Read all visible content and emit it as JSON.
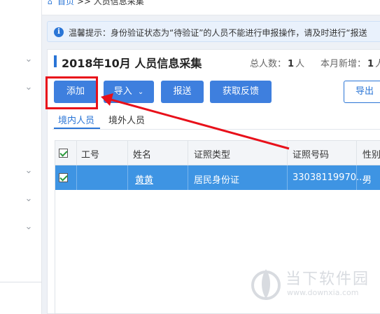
{
  "breadcrumb": {
    "home": "首页",
    "separator": ">>",
    "current": "人员信息采集"
  },
  "notice": {
    "text": "温馨提示：身份验证状态为“待验证”的人员不能进行申报操作，请及时进行“报送"
  },
  "header": {
    "title": "2018年10月  人员信息采集",
    "total_label": "总人数：",
    "total_value": "1",
    "total_unit": "人",
    "new_label": "本月新增：",
    "new_value": "1",
    "new_unit": "人"
  },
  "toolbar": {
    "add_label": "添加",
    "import_label": "导入",
    "submit_label": "报送",
    "feedback_label": "获取反馈",
    "export_label": "导出"
  },
  "tabs": [
    {
      "label": "境内人员",
      "active": true
    },
    {
      "label": "境外人员",
      "active": false
    }
  ],
  "table": {
    "columns": [
      "工号",
      "姓名",
      "证照类型",
      "证照号码",
      "性别"
    ],
    "rows": [
      {
        "checked": true,
        "employee_id": "",
        "name": "黄黄",
        "id_type": "居民身份证",
        "id_number": "33038119970...",
        "gender": "男"
      }
    ]
  },
  "watermark": {
    "title": "当下软件园",
    "url": "www.downxia.com"
  },
  "colors": {
    "accent": "#3e7fde",
    "highlight_red": "#e8101a",
    "selected_row": "#3e94e3"
  },
  "icons": {
    "home": "home-icon",
    "info": "info-icon",
    "chevron": "chevron-down-icon",
    "checkbox": "checkbox-checked-icon"
  }
}
